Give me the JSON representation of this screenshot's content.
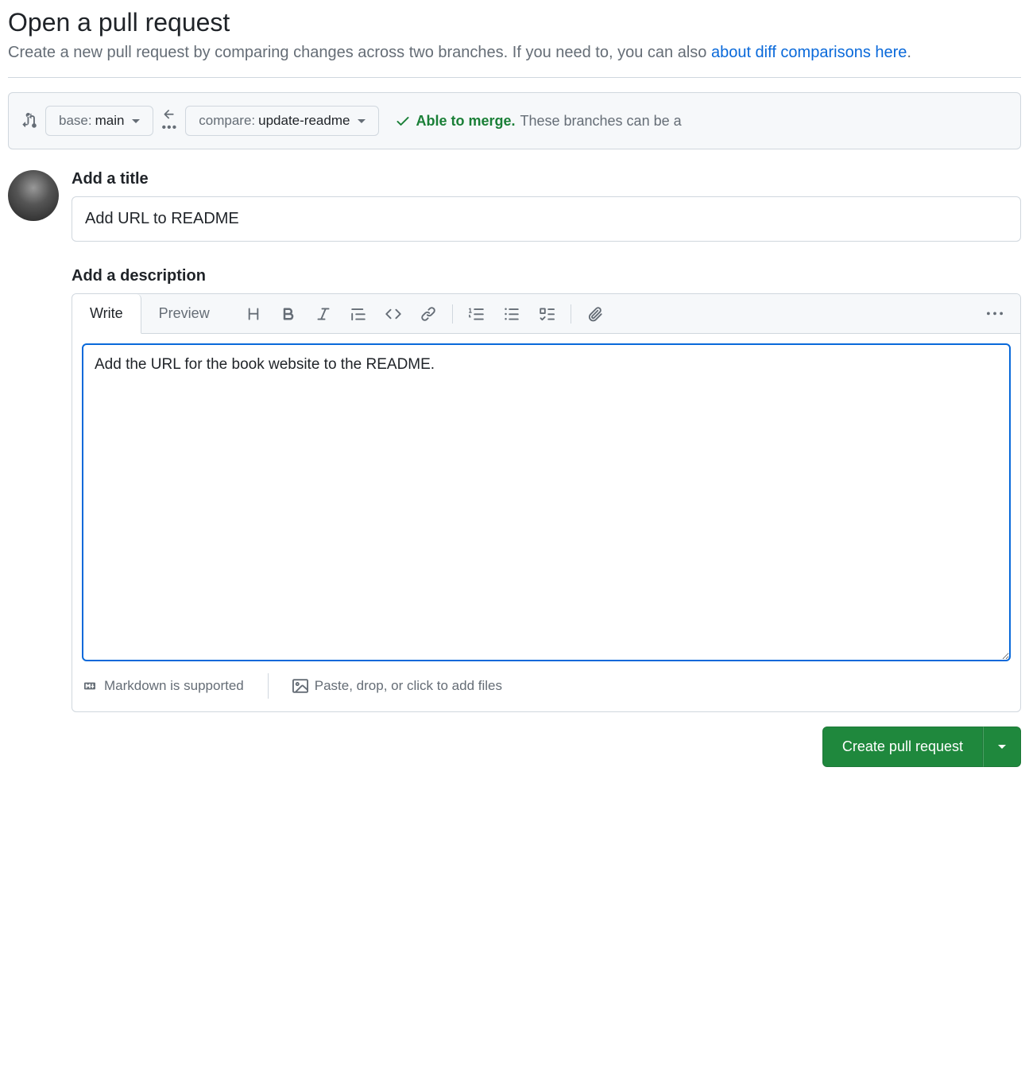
{
  "header": {
    "title": "Open a pull request",
    "subtitle_prefix": "Create a new pull request by comparing changes across two branches. If you need to, you can also ",
    "subtitle_link": "about diff comparisons here",
    "subtitle_suffix": "."
  },
  "compare": {
    "base_prefix": "base: ",
    "base_branch": "main",
    "compare_prefix": "compare: ",
    "compare_branch": "update-readme",
    "merge_able": "Able to merge.",
    "merge_rest": "These branches can be a"
  },
  "form": {
    "title_label": "Add a title",
    "title_value": "Add URL to README",
    "description_label": "Add a description",
    "description_value": "Add the URL for the book website to the README."
  },
  "tabs": {
    "write": "Write",
    "preview": "Preview"
  },
  "footer": {
    "markdown": "Markdown is supported",
    "files": "Paste, drop, or click to add files"
  },
  "actions": {
    "create": "Create pull request"
  }
}
